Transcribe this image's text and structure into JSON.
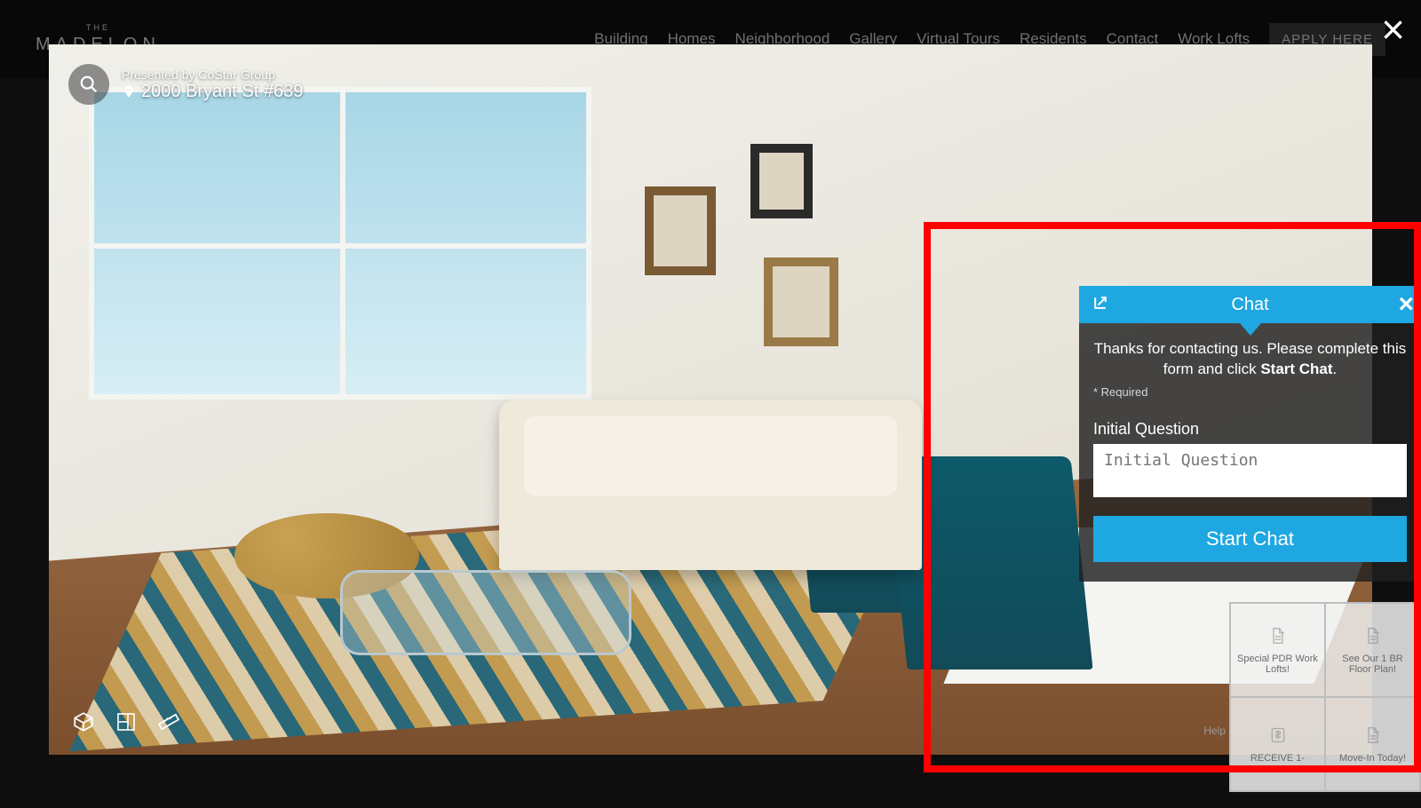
{
  "brand": {
    "the": "THE",
    "name": "MADELON"
  },
  "nav": {
    "items": [
      "Building",
      "Homes",
      "Neighborhood",
      "Gallery",
      "Virtual Tours",
      "Residents",
      "Contact",
      "Work Lofts"
    ],
    "apply": "APPLY HERE"
  },
  "tour": {
    "presented_by": "Presented by CoStar Group",
    "address": "2000 Bryant St #639"
  },
  "chat": {
    "title": "Chat",
    "message_pre": "Thanks for contacting us. Please complete this form and click ",
    "message_bold": "Start Chat",
    "message_post": ".",
    "required": "* Required",
    "field_label": "Initial Question",
    "field_placeholder": "Initial Question",
    "start_button": "Start Chat"
  },
  "promos": [
    "Special PDR Work Lofts!",
    "See Our 1 BR Floor Plan!",
    "RECEIVE 1-",
    "Move-In Today!"
  ],
  "help_label": "Help"
}
